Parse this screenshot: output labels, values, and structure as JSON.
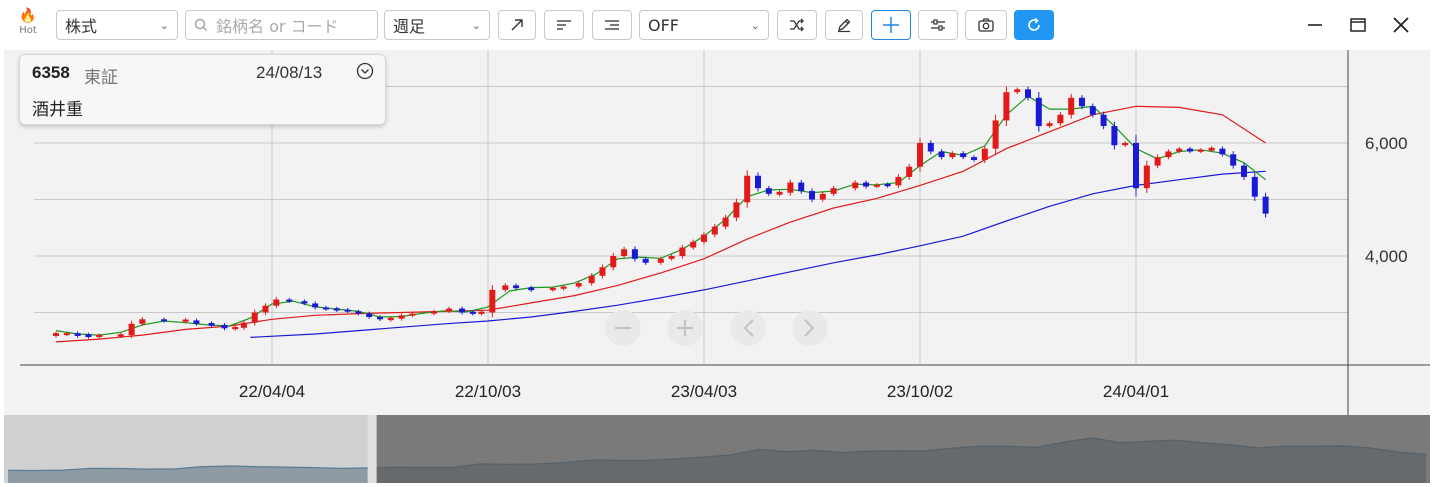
{
  "toolbar": {
    "hot_label": "Hot",
    "asset_type": "株式",
    "search_placeholder": "銘柄名 or コード",
    "period": "週足",
    "indicator": "OFF"
  },
  "info_card": {
    "code": "6358",
    "market": "東証",
    "date": "24/08/13",
    "name": "酒井重"
  },
  "colors": {
    "up": "#e31a1a",
    "down": "#1a1ad6",
    "ma_short": "#1a9a1a",
    "ma_mid": "#e31a1a",
    "ma_long": "#1a1ad6",
    "accent": "#2196f3"
  },
  "nav_icons": [
    "minus-icon",
    "plus-icon",
    "chevron-left-icon",
    "chevron-right-icon"
  ],
  "chart_data": {
    "type": "candlestick",
    "x_tick_labels": [
      "22/04/04",
      "22/10/03",
      "23/04/03",
      "23/10/02",
      "24/04/01"
    ],
    "y_tick_labels": [
      "4,000",
      "6,000"
    ],
    "ylim": [
      2000,
      7400
    ],
    "grid": true,
    "series_names": [],
    "closes": [
      [
        0,
        2620
      ],
      [
        0.5,
        2620
      ],
      [
        1,
        2600
      ],
      [
        1.5,
        2580
      ],
      [
        2,
        2590
      ],
      [
        3,
        2600
      ],
      [
        3.5,
        2800
      ],
      [
        4,
        2880
      ],
      [
        5,
        2850
      ],
      [
        6,
        2860
      ],
      [
        6.5,
        2800
      ],
      [
        7.2,
        2780
      ],
      [
        7.8,
        2720
      ],
      [
        8.3,
        2730
      ],
      [
        8.7,
        2820
      ],
      [
        9.2,
        3000
      ],
      [
        9.7,
        3120
      ],
      [
        10.2,
        3230
      ],
      [
        10.8,
        3200
      ],
      [
        11.5,
        3160
      ],
      [
        12,
        3090
      ],
      [
        12.5,
        3060
      ],
      [
        13,
        3050
      ],
      [
        13.5,
        3020
      ],
      [
        14,
        2980
      ],
      [
        14.5,
        2920
      ],
      [
        15,
        2880
      ],
      [
        15.5,
        2890
      ],
      [
        16,
        2950
      ],
      [
        16.5,
        2980
      ],
      [
        17.5,
        3020
      ],
      [
        18.2,
        3070
      ],
      [
        18.8,
        3000
      ],
      [
        19.3,
        2990
      ],
      [
        19.7,
        3000
      ],
      [
        20.2,
        3400
      ],
      [
        20.8,
        3480
      ],
      [
        21.3,
        3430
      ],
      [
        22,
        3410
      ],
      [
        23,
        3420
      ],
      [
        23.5,
        3460
      ],
      [
        24.2,
        3520
      ],
      [
        24.8,
        3650
      ],
      [
        25.3,
        3800
      ],
      [
        25.8,
        4000
      ],
      [
        26.3,
        4120
      ],
      [
        26.8,
        3950
      ],
      [
        27.3,
        3880
      ],
      [
        28,
        3950
      ],
      [
        28.5,
        4000
      ],
      [
        29,
        4150
      ],
      [
        29.5,
        4250
      ],
      [
        30,
        4380
      ],
      [
        30.5,
        4520
      ],
      [
        31,
        4680
      ],
      [
        31.5,
        4950
      ],
      [
        32,
        5420
      ],
      [
        32.5,
        5200
      ],
      [
        33,
        5100
      ],
      [
        33.5,
        5120
      ],
      [
        34,
        5300
      ],
      [
        34.5,
        5150
      ],
      [
        35,
        5000
      ],
      [
        35.5,
        5100
      ],
      [
        36,
        5200
      ],
      [
        37,
        5300
      ],
      [
        37.5,
        5230
      ],
      [
        38,
        5260
      ],
      [
        38.5,
        5250
      ],
      [
        39,
        5400
      ],
      [
        39.5,
        5580
      ],
      [
        40,
        6000
      ],
      [
        40.5,
        5850
      ],
      [
        41,
        5750
      ],
      [
        41.5,
        5820
      ],
      [
        42,
        5750
      ],
      [
        42.5,
        5700
      ],
      [
        43,
        5900
      ],
      [
        43.5,
        6400
      ],
      [
        44,
        6900
      ],
      [
        44.5,
        6950
      ],
      [
        45,
        6800
      ],
      [
        45.5,
        6300
      ],
      [
        46,
        6350
      ],
      [
        46.5,
        6500
      ],
      [
        47,
        6800
      ],
      [
        47.5,
        6650
      ],
      [
        48,
        6500
      ],
      [
        48.5,
        6300
      ],
      [
        49,
        5960
      ],
      [
        49.5,
        6000
      ],
      [
        50,
        5200
      ],
      [
        50.5,
        5600
      ],
      [
        51,
        5750
      ],
      [
        51.5,
        5850
      ],
      [
        52,
        5900
      ],
      [
        52.5,
        5850
      ],
      [
        53,
        5880
      ],
      [
        53.5,
        5900
      ],
      [
        54,
        5800
      ],
      [
        54.5,
        5600
      ],
      [
        55,
        5400
      ],
      [
        55.5,
        5050
      ],
      [
        56,
        4750
      ]
    ],
    "ma_short": [
      [
        0,
        2680
      ],
      [
        1,
        2620
      ],
      [
        2,
        2600
      ],
      [
        3,
        2650
      ],
      [
        4,
        2780
      ],
      [
        5,
        2850
      ],
      [
        6,
        2820
      ],
      [
        7,
        2780
      ],
      [
        8,
        2760
      ],
      [
        9,
        2900
      ],
      [
        10,
        3150
      ],
      [
        11,
        3200
      ],
      [
        12,
        3100
      ],
      [
        13,
        3060
      ],
      [
        14,
        3020
      ],
      [
        15,
        2920
      ],
      [
        16,
        2930
      ],
      [
        17,
        2990
      ],
      [
        18,
        3030
      ],
      [
        19,
        3010
      ],
      [
        20,
        3100
      ],
      [
        21,
        3380
      ],
      [
        22,
        3440
      ],
      [
        23,
        3450
      ],
      [
        24,
        3520
      ],
      [
        25,
        3680
      ],
      [
        26,
        3950
      ],
      [
        27,
        3980
      ],
      [
        28,
        3960
      ],
      [
        29,
        4120
      ],
      [
        30,
        4350
      ],
      [
        31,
        4650
      ],
      [
        32,
        5050
      ],
      [
        33,
        5170
      ],
      [
        34,
        5180
      ],
      [
        35,
        5120
      ],
      [
        36,
        5150
      ],
      [
        37,
        5270
      ],
      [
        38,
        5260
      ],
      [
        39,
        5300
      ],
      [
        40,
        5600
      ],
      [
        41,
        5850
      ],
      [
        42,
        5780
      ],
      [
        43,
        5950
      ],
      [
        44,
        6500
      ],
      [
        45,
        6830
      ],
      [
        46,
        6600
      ],
      [
        47,
        6600
      ],
      [
        48,
        6650
      ],
      [
        49,
        6300
      ],
      [
        50,
        5900
      ],
      [
        51,
        5720
      ],
      [
        52,
        5850
      ],
      [
        53,
        5880
      ],
      [
        54,
        5820
      ],
      [
        55,
        5650
      ],
      [
        56,
        5350
      ]
    ],
    "ma_mid": [
      [
        0,
        2480
      ],
      [
        2,
        2530
      ],
      [
        4,
        2600
      ],
      [
        6,
        2700
      ],
      [
        8,
        2760
      ],
      [
        10,
        2880
      ],
      [
        12,
        2950
      ],
      [
        14,
        2980
      ],
      [
        16,
        3000
      ],
      [
        18,
        3020
      ],
      [
        20,
        3040
      ],
      [
        22,
        3170
      ],
      [
        24,
        3300
      ],
      [
        26,
        3480
      ],
      [
        28,
        3700
      ],
      [
        30,
        3950
      ],
      [
        32,
        4300
      ],
      [
        34,
        4600
      ],
      [
        36,
        4850
      ],
      [
        38,
        5020
      ],
      [
        40,
        5250
      ],
      [
        42,
        5500
      ],
      [
        44,
        5900
      ],
      [
        46,
        6200
      ],
      [
        48,
        6500
      ],
      [
        50,
        6650
      ],
      [
        52,
        6630
      ],
      [
        54,
        6500
      ],
      [
        56,
        6000
      ]
    ],
    "ma_long": [
      [
        9,
        2560
      ],
      [
        12,
        2620
      ],
      [
        14,
        2680
      ],
      [
        16,
        2740
      ],
      [
        18,
        2800
      ],
      [
        20,
        2850
      ],
      [
        22,
        2920
      ],
      [
        24,
        3020
      ],
      [
        26,
        3130
      ],
      [
        28,
        3260
      ],
      [
        30,
        3400
      ],
      [
        32,
        3560
      ],
      [
        34,
        3720
      ],
      [
        36,
        3880
      ],
      [
        38,
        4020
      ],
      [
        40,
        4180
      ],
      [
        42,
        4350
      ],
      [
        44,
        4620
      ],
      [
        46,
        4880
      ],
      [
        48,
        5100
      ],
      [
        50,
        5250
      ],
      [
        52,
        5350
      ],
      [
        54,
        5450
      ],
      [
        56,
        5500
      ]
    ],
    "minimap_values": [
      2620,
      2600,
      2650,
      2880,
      2860,
      2780,
      2820,
      3120,
      3200,
      3090,
      3050,
      2980,
      2880,
      2950,
      3020,
      3000,
      3000,
      3480,
      3410,
      3460,
      3650,
      4000,
      3950,
      3950,
      4150,
      4380,
      4680,
      5420,
      5100,
      5300,
      5000,
      5200,
      5230,
      5250,
      5580,
      5850,
      5820,
      5700,
      6400,
      6950,
      6300,
      6500,
      6650,
      6300,
      6000,
      5600,
      5850,
      5850,
      5900,
      5600,
      5050,
      4750
    ],
    "minimap_window": [
      0.255,
      1.0
    ]
  }
}
